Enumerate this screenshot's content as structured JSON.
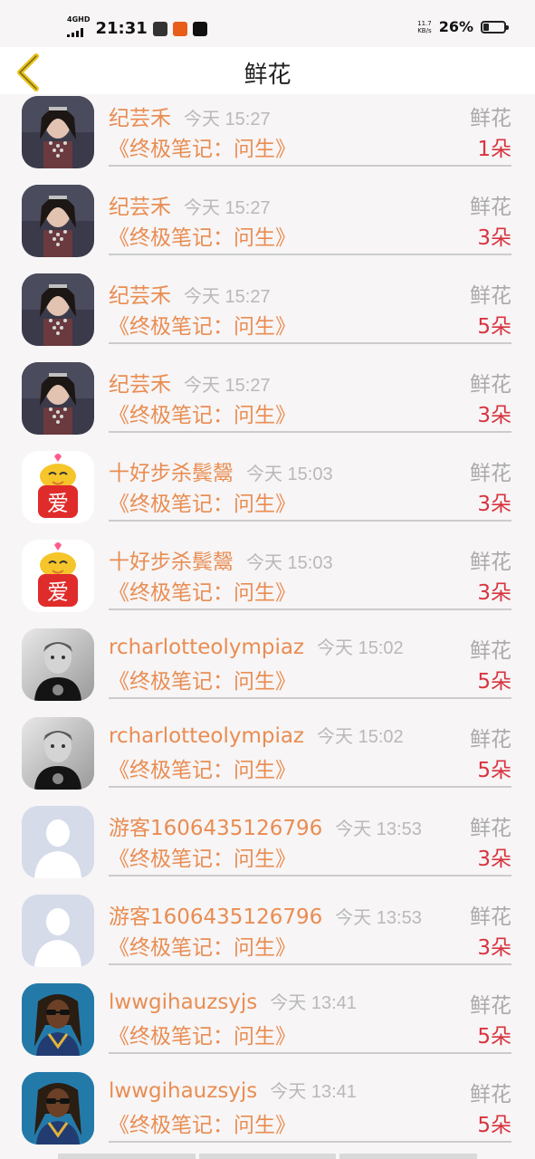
{
  "status_bar": {
    "network": "4GHD",
    "time": "21:31",
    "speed_value": "11.7",
    "speed_unit": "KB/s",
    "battery": "26%",
    "battery_level": 0.26
  },
  "nav": {
    "back_icon": "chevron-left-icon",
    "title": "鲜花"
  },
  "list": [
    {
      "name": "纪芸禾",
      "time": "今天 15:27",
      "label": "鲜花",
      "book": "《终极笔记：问生》",
      "count": "1朵",
      "avatar": "portrait-woman"
    },
    {
      "name": "纪芸禾",
      "time": "今天 15:27",
      "label": "鲜花",
      "book": "《终极笔记：问生》",
      "count": "3朵",
      "avatar": "portrait-woman"
    },
    {
      "name": "纪芸禾",
      "time": "今天 15:27",
      "label": "鲜花",
      "book": "《终极笔记：问生》",
      "count": "5朵",
      "avatar": "portrait-woman"
    },
    {
      "name": "纪芸禾",
      "time": "今天 15:27",
      "label": "鲜花",
      "book": "《终极笔记：问生》",
      "count": "3朵",
      "avatar": "portrait-woman"
    },
    {
      "name": "十好步杀鬓鬶",
      "time": "今天 15:03",
      "label": "鲜花",
      "book": "《终极笔记：问生》",
      "count": "3朵",
      "avatar": "love-mascot",
      "avatar_text": "爱"
    },
    {
      "name": "十好步杀鬓鬶",
      "time": "今天 15:03",
      "label": "鲜花",
      "book": "《终极笔记：问生》",
      "count": "3朵",
      "avatar": "love-mascot",
      "avatar_text": "爱"
    },
    {
      "name": "rcharlotteolympiaz",
      "time": "今天 15:02",
      "label": "鲜花",
      "book": "《终极笔记：问生》",
      "count": "5朵",
      "avatar": "boy-photo"
    },
    {
      "name": "rcharlotteolympiaz",
      "time": "今天 15:02",
      "label": "鲜花",
      "book": "《终极笔记：问生》",
      "count": "5朵",
      "avatar": "boy-photo"
    },
    {
      "name": "游客1606435126796",
      "time": "今天 13:53",
      "label": "鲜花",
      "book": "《终极笔记：问生》",
      "count": "3朵",
      "avatar": "default-user"
    },
    {
      "name": "游客1606435126796",
      "time": "今天 13:53",
      "label": "鲜花",
      "book": "《终极笔记：问生》",
      "count": "3朵",
      "avatar": "default-user"
    },
    {
      "name": "lwwgihauzsyjs",
      "time": "今天 13:41",
      "label": "鲜花",
      "book": "《终极笔记：问生》",
      "count": "5朵",
      "avatar": "man-sunglasses"
    },
    {
      "name": "lwwgihauzsyjs",
      "time": "今天 13:41",
      "label": "鲜花",
      "book": "《终极笔记：问生》",
      "count": "5朵",
      "avatar": "man-sunglasses"
    }
  ],
  "colors": {
    "name": "#e98d52",
    "count": "#d8343f",
    "muted": "#aaaaaa",
    "back_icon": "#e7c21c"
  }
}
